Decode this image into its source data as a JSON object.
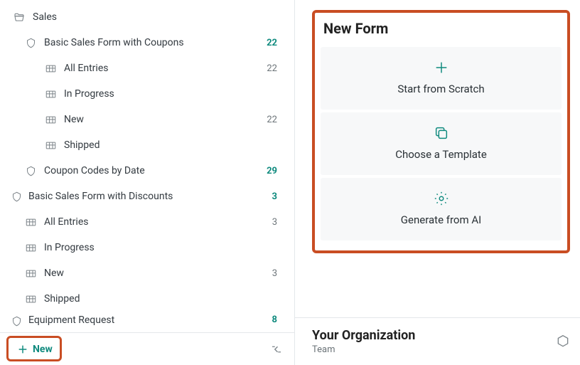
{
  "sidebar": {
    "sales": {
      "label": "Sales",
      "forms": [
        {
          "label": "Basic Sales Form with Coupons",
          "count": "22",
          "views": [
            {
              "label": "All Entries",
              "count": "22"
            },
            {
              "label": "In Progress",
              "count": ""
            },
            {
              "label": "New",
              "count": "22"
            },
            {
              "label": "Shipped",
              "count": ""
            }
          ]
        },
        {
          "label": "Coupon Codes by Date",
          "count": "29"
        }
      ]
    },
    "discounts": {
      "label": "Basic Sales Form with Discounts",
      "count": "3",
      "views": [
        {
          "label": "All Entries",
          "count": "3"
        },
        {
          "label": "In Progress",
          "count": ""
        },
        {
          "label": "New",
          "count": "3"
        },
        {
          "label": "Shipped",
          "count": ""
        }
      ]
    },
    "equipment": {
      "label": "Equipment Request",
      "count": "8"
    },
    "new_button": "New"
  },
  "new_form": {
    "title": "New Form",
    "tiles": [
      {
        "label": "Start from Scratch"
      },
      {
        "label": "Choose a Template"
      },
      {
        "label": "Generate from AI"
      }
    ]
  },
  "org": {
    "title": "Your Organization",
    "subtitle": "Team"
  }
}
